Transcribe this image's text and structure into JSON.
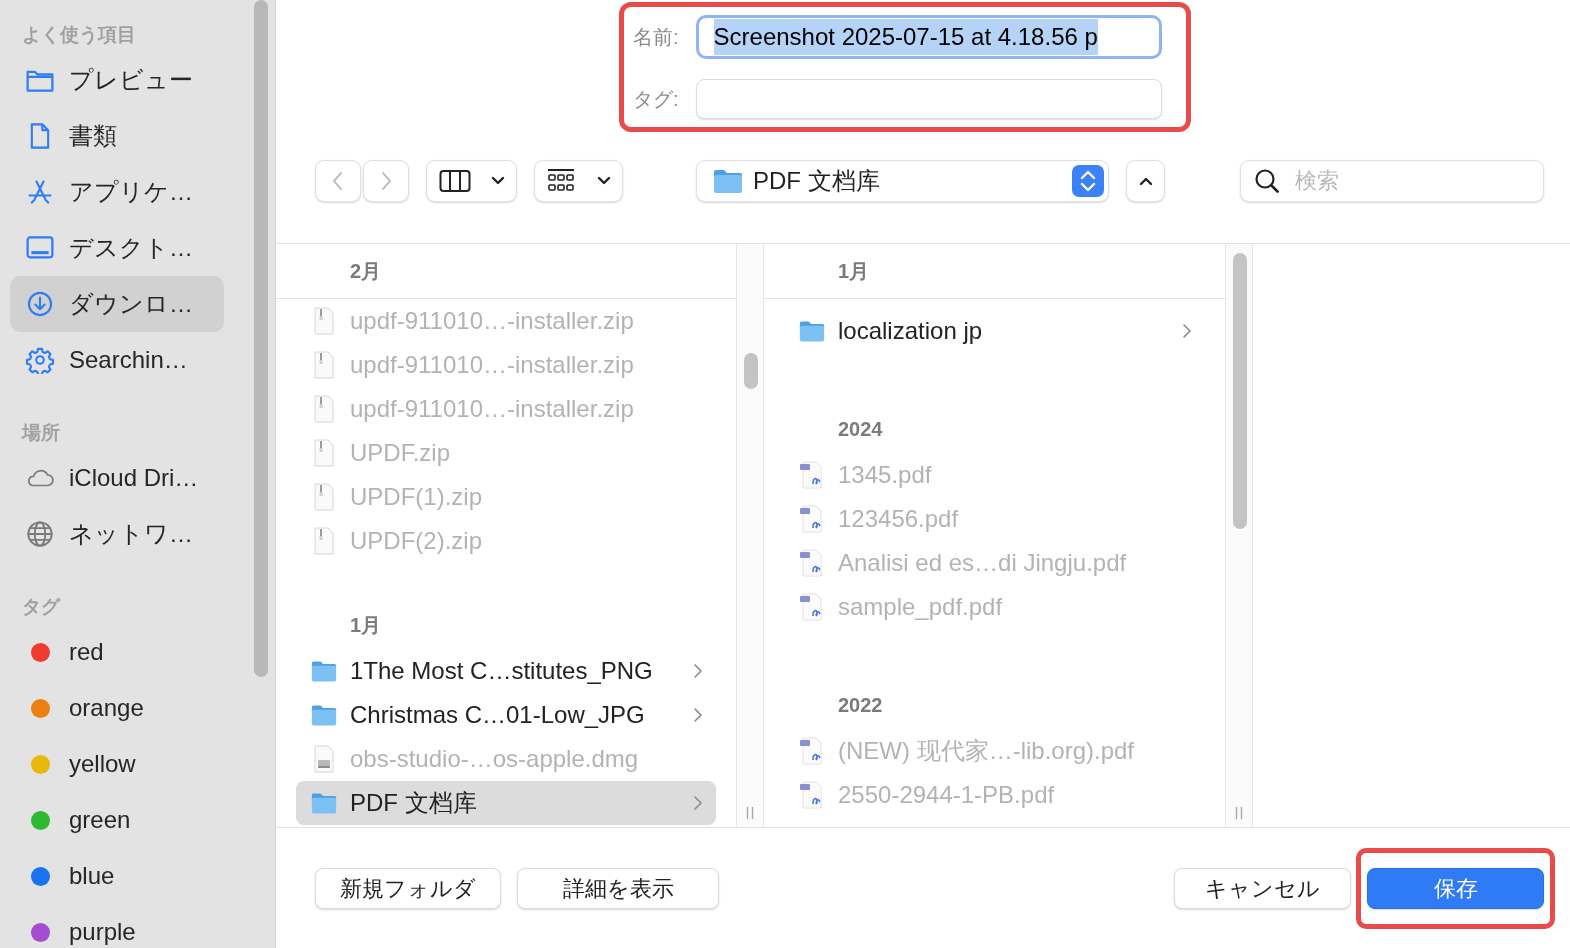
{
  "sidebar": {
    "sections": [
      {
        "title": "よく使う項目",
        "items": [
          {
            "label": "プレビュー",
            "kind": "folder",
            "selected": false
          },
          {
            "label": "書類",
            "kind": "document",
            "selected": false
          },
          {
            "label": "アプリケ…",
            "kind": "apps",
            "selected": false
          },
          {
            "label": "デスクト…",
            "kind": "desktop",
            "selected": false
          },
          {
            "label": "ダウンロ…",
            "kind": "download",
            "selected": true
          },
          {
            "label": "Searchin…",
            "kind": "gear",
            "selected": false
          }
        ]
      },
      {
        "title": "場所",
        "items": [
          {
            "label": "iCloud Dri…",
            "kind": "cloud",
            "selected": false
          },
          {
            "label": "ネットワ…",
            "kind": "globe",
            "selected": false
          }
        ]
      },
      {
        "title": "タグ",
        "items": [
          {
            "label": "red",
            "kind": "tag",
            "color": "#f13a32",
            "selected": false
          },
          {
            "label": "orange",
            "kind": "tag",
            "color": "#e9800f",
            "selected": false
          },
          {
            "label": "yellow",
            "kind": "tag",
            "color": "#eab70b",
            "selected": false
          },
          {
            "label": "green",
            "kind": "tag",
            "color": "#2dba32",
            "selected": false
          },
          {
            "label": "blue",
            "kind": "tag",
            "color": "#1a73f0",
            "selected": false
          },
          {
            "label": "purple",
            "kind": "tag",
            "color": "#a44ccf",
            "selected": false
          }
        ]
      }
    ]
  },
  "save_form": {
    "highlighted": true,
    "name_label": "名前:",
    "name_value": "Screenshot 2025-07-15 at 4.18.56 p",
    "name_focused": true,
    "name_text_selected": true,
    "tags_label": "タグ:"
  },
  "toolbar": {
    "nav": [
      {
        "kind": "back",
        "disabled": true
      },
      {
        "kind": "forward",
        "disabled": true
      }
    ],
    "location": "PDF 文档库",
    "search_placeholder": "検索"
  },
  "columns": [
    {
      "groups": [
        {
          "heading": "2月",
          "items": [
            {
              "name": "updf-911010…-installer.zip",
              "kind": "zip",
              "disabled": true,
              "selected": false
            },
            {
              "name": "updf-911010…-installer.zip",
              "kind": "zip",
              "disabled": true,
              "selected": false
            },
            {
              "name": "updf-911010…-installer.zip",
              "kind": "zip",
              "disabled": true,
              "selected": false
            },
            {
              "name": "UPDF.zip",
              "kind": "zip",
              "disabled": true,
              "selected": false
            },
            {
              "name": "UPDF(1).zip",
              "kind": "zip",
              "disabled": true,
              "selected": false
            },
            {
              "name": "UPDF(2).zip",
              "kind": "zip",
              "disabled": true,
              "selected": false
            }
          ]
        },
        {
          "heading": "1月",
          "items": [
            {
              "name": "1The Most C…stitutes_PNG",
              "kind": "folder",
              "disabled": false,
              "selected": false
            },
            {
              "name": "Christmas C…01-Low_JPG",
              "kind": "folder",
              "disabled": false,
              "selected": false
            },
            {
              "name": "obs-studio-…os-apple.dmg",
              "kind": "disk_image",
              "disabled": true,
              "selected": false
            },
            {
              "name": "PDF 文档库",
              "kind": "folder",
              "disabled": false,
              "selected": true
            }
          ]
        }
      ]
    },
    {
      "groups": [
        {
          "heading": "1月",
          "items": [
            {
              "name": "localization jp",
              "kind": "folder",
              "disabled": false,
              "selected": false
            }
          ]
        },
        {
          "heading": "2024",
          "items": [
            {
              "name": "1345.pdf",
              "kind": "pdf",
              "disabled": true,
              "selected": false
            },
            {
              "name": "123456.pdf",
              "kind": "pdf",
              "disabled": true,
              "selected": false
            },
            {
              "name": "Analisi ed es…di Jingju.pdf",
              "kind": "pdf",
              "disabled": true,
              "selected": false
            },
            {
              "name": "sample_pdf.pdf",
              "kind": "pdf",
              "disabled": true,
              "selected": false
            }
          ]
        },
        {
          "heading": "2022",
          "items": [
            {
              "name": "(NEW) 现代家…-lib.org).pdf",
              "kind": "pdf",
              "disabled": true,
              "selected": false
            },
            {
              "name": "2550-2944-1-PB.pdf",
              "kind": "pdf",
              "disabled": true,
              "selected": false
            }
          ]
        }
      ]
    }
  ],
  "bottom_bar": {
    "save_highlighted": true,
    "left_buttons": [
      {
        "label": "新規フォルダ",
        "kind": "secondary"
      },
      {
        "label": "詳細を表示",
        "kind": "secondary"
      }
    ],
    "right_buttons": [
      {
        "label": "キャンセル",
        "kind": "secondary"
      },
      {
        "label": "保存",
        "kind": "primary"
      }
    ]
  }
}
